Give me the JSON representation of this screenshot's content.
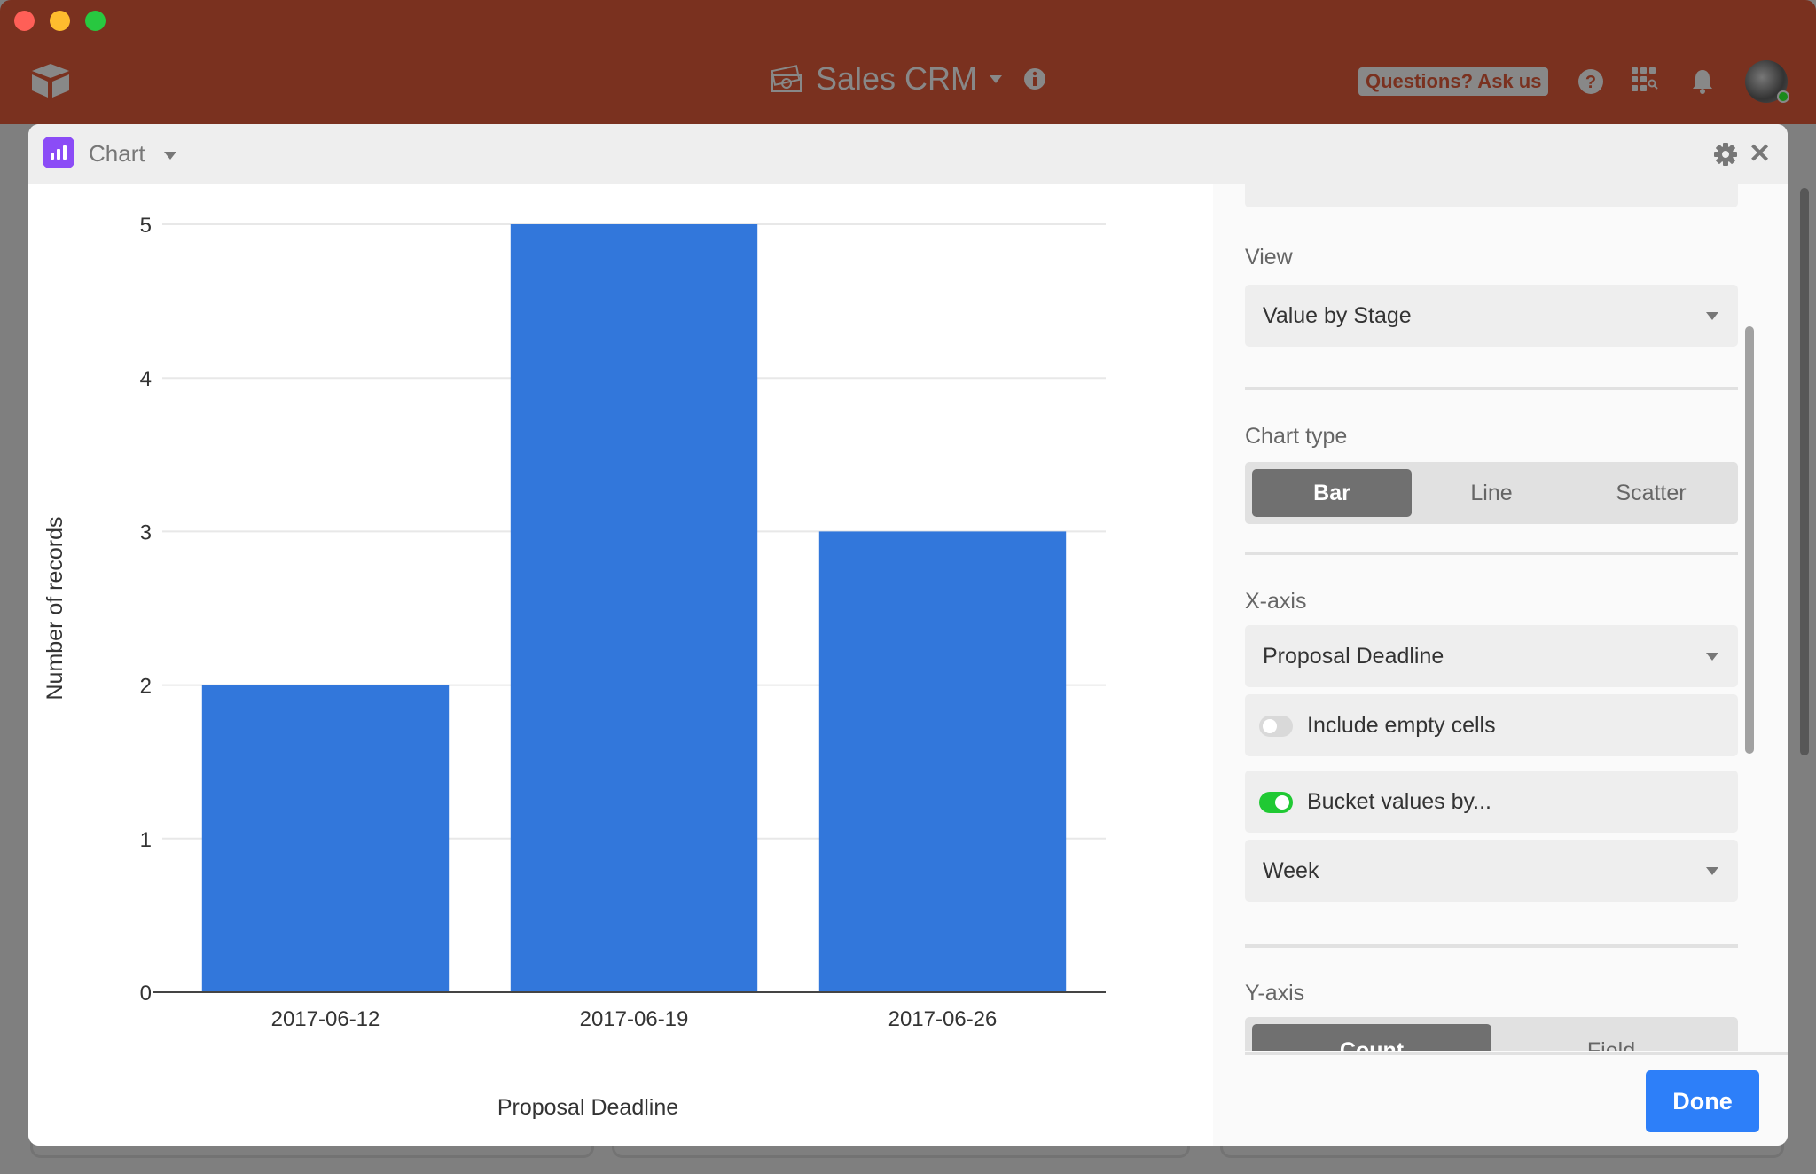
{
  "window": {
    "traffic_lights": [
      "#ff5f57",
      "#febc2e",
      "#28c840"
    ],
    "base_name": "Sales CRM",
    "base_icon": "money-icon",
    "ask_button": "Questions? Ask us",
    "colors": {
      "titlebar": "#7a311f",
      "accent_blue": "#2d7ff9",
      "bar_blue": "#3277db",
      "toggle_on": "#20c933"
    }
  },
  "modal": {
    "title": "Chart",
    "done_label": "Done"
  },
  "settings": {
    "view_label": "View",
    "view_value": "Value by Stage",
    "chart_type_label": "Chart type",
    "chart_types": [
      "Bar",
      "Line",
      "Scatter"
    ],
    "chart_type_selected": "Bar",
    "xaxis_label": "X-axis",
    "xaxis_field": "Proposal Deadline",
    "include_empty_label": "Include empty cells",
    "include_empty_on": false,
    "bucket_label": "Bucket values by...",
    "bucket_on": true,
    "bucket_value": "Week",
    "yaxis_label": "Y-axis",
    "yaxis_modes": [
      "Count",
      "Field"
    ],
    "yaxis_selected": "Count"
  },
  "chart_data": {
    "type": "bar",
    "title": "",
    "xlabel": "Proposal Deadline",
    "ylabel": "Number of records",
    "categories": [
      "2017-06-12",
      "2017-06-19",
      "2017-06-26"
    ],
    "values": [
      2,
      5,
      3
    ],
    "ylim": [
      0,
      5
    ],
    "yticks": [
      0,
      1,
      2,
      3,
      4,
      5
    ],
    "grid": true,
    "legend": "none"
  }
}
